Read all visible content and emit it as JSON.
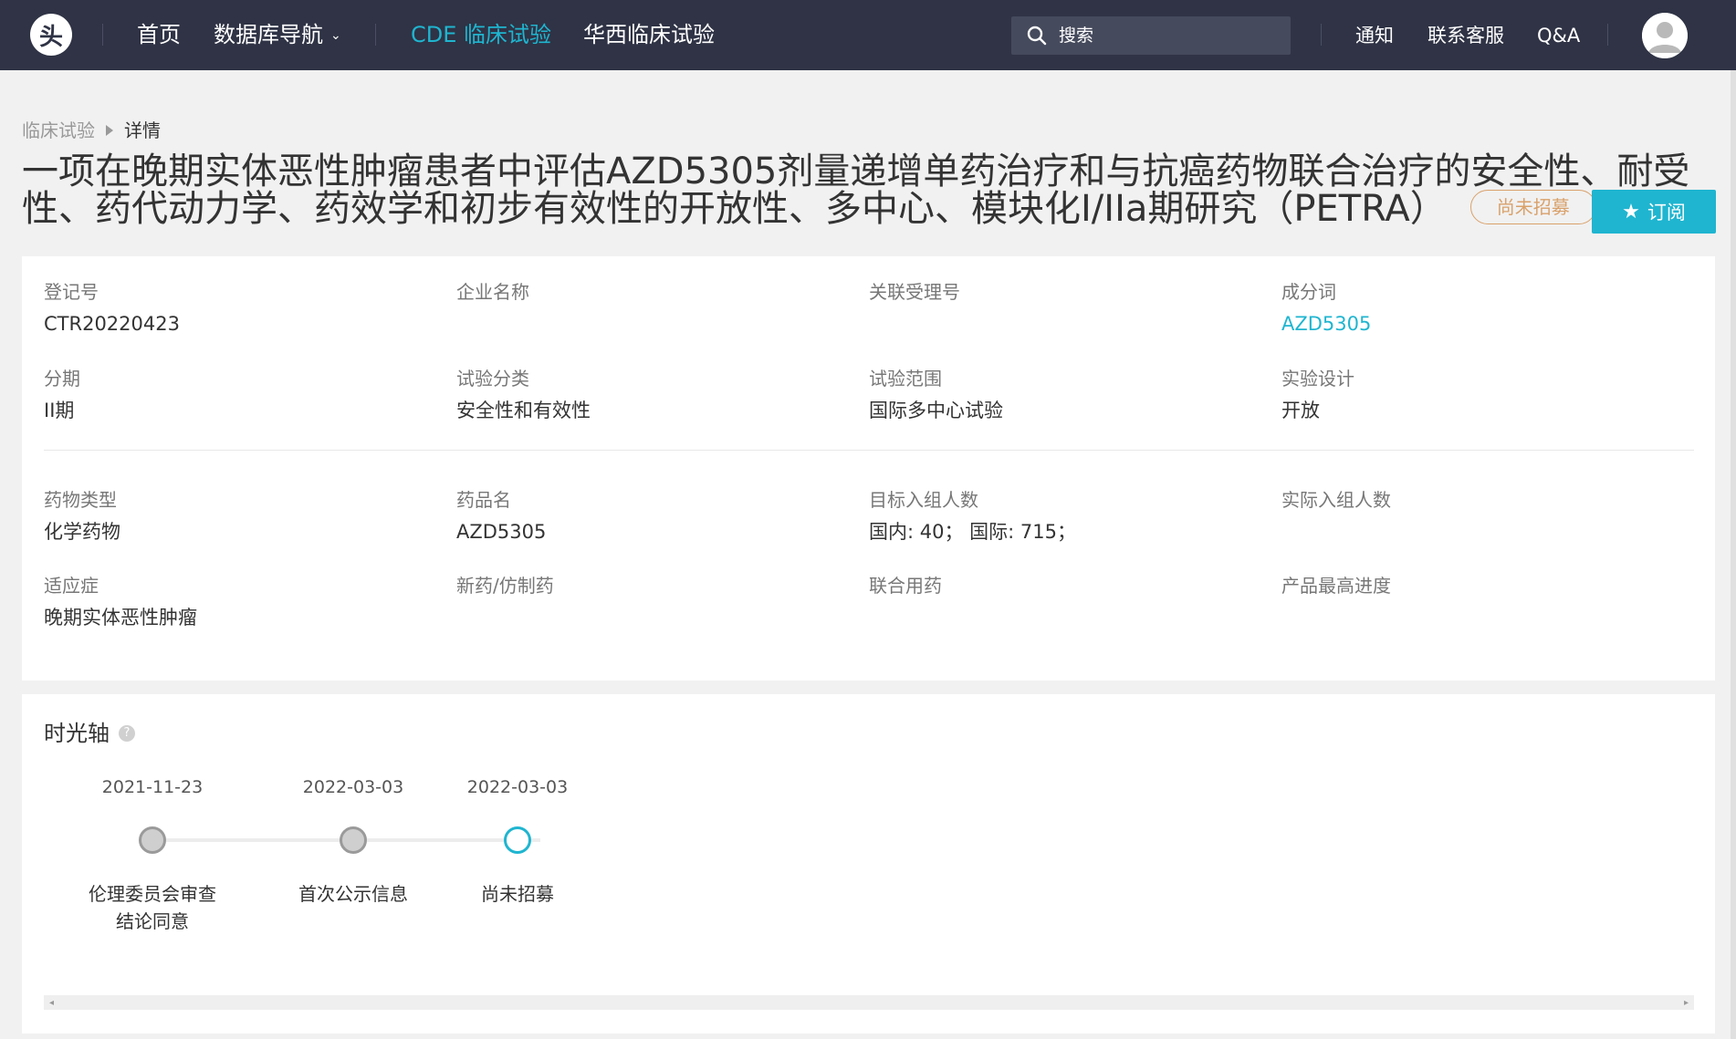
{
  "nav": {
    "logo_text": "头",
    "home": "首页",
    "db_nav": "数据库导航",
    "cde": "CDE 临床试验",
    "huaxi": "华西临床试验",
    "search_placeholder": "搜索",
    "notice": "通知",
    "service": "联系客服",
    "qa": "Q&A"
  },
  "breadcrumb": {
    "parent": "临床试验",
    "current": "详情"
  },
  "title": "一项在晚期实体恶性肿瘤患者中评估AZD5305剂量递增单药治疗和与抗癌药物联合治疗的安全性、耐受性、药代动力学、药效学和初步有效性的开放性、多中心、模块化I/IIa期研究（PETRA）",
  "status_tag": "尚未招募",
  "subscribe": {
    "icon": "★",
    "label": "订阅"
  },
  "info": {
    "reg_no": {
      "label": "登记号",
      "value": "CTR20220423"
    },
    "company": {
      "label": "企业名称",
      "value": ""
    },
    "related_no": {
      "label": "关联受理号",
      "value": ""
    },
    "ingredient": {
      "label": "成分词",
      "value": "AZD5305"
    },
    "phase": {
      "label": "分期",
      "value": "II期"
    },
    "category": {
      "label": "试验分类",
      "value": "安全性和有效性"
    },
    "scope": {
      "label": "试验范围",
      "value": "国际多中心试验"
    },
    "design": {
      "label": "实验设计",
      "value": "开放"
    },
    "drug_type": {
      "label": "药物类型",
      "value": "化学药物"
    },
    "drug_name": {
      "label": "药品名",
      "value": "AZD5305"
    },
    "target_enroll": {
      "label": "目标入组人数",
      "value": "国内: 40；  国际: 715；"
    },
    "actual_enroll": {
      "label": "实际入组人数",
      "value": ""
    },
    "indication": {
      "label": "适应症",
      "value": "晚期实体恶性肿瘤"
    },
    "new_generic": {
      "label": "新药/仿制药",
      "value": ""
    },
    "combo": {
      "label": "联合用药",
      "value": ""
    },
    "progress": {
      "label": "产品最高进度",
      "value": ""
    }
  },
  "timeline": {
    "title": "时光轴",
    "help": "?",
    "events": [
      {
        "date": "2021-11-23",
        "label": "伦理委员会审查结论同意",
        "current": false
      },
      {
        "date": "2022-03-03",
        "label": "首次公示信息",
        "current": false
      },
      {
        "date": "2022-03-03",
        "label": "尚未招募",
        "current": true
      }
    ]
  },
  "colors": {
    "nav_bg": "#2f3345",
    "accent": "#1fb5d0",
    "status": "#d9a16b"
  }
}
